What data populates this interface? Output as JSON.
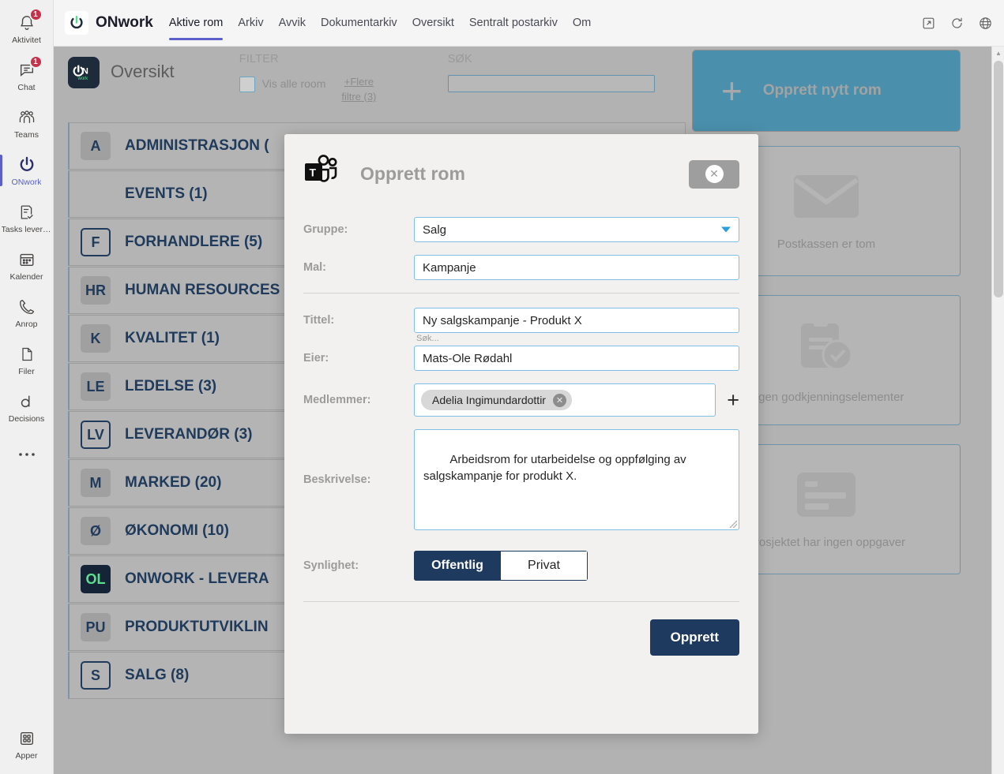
{
  "rail": {
    "items": [
      {
        "label": "Aktivitet",
        "icon": "bell-icon",
        "badge": "1",
        "active": false
      },
      {
        "label": "Chat",
        "icon": "chat-icon",
        "badge": "1",
        "active": false
      },
      {
        "label": "Teams",
        "icon": "teams-people-icon",
        "badge": "",
        "active": false
      },
      {
        "label": "ONwork",
        "icon": "power-icon",
        "badge": "",
        "active": true
      },
      {
        "label": "Tasks levert...",
        "icon": "tasks-icon",
        "badge": "",
        "active": false
      },
      {
        "label": "Kalender",
        "icon": "calendar-icon",
        "badge": "",
        "active": false
      },
      {
        "label": "Anrop",
        "icon": "phone-icon",
        "badge": "",
        "active": false
      },
      {
        "label": "Filer",
        "icon": "file-icon",
        "badge": "",
        "active": false
      },
      {
        "label": "Decisions",
        "icon": "decisions-icon",
        "badge": "",
        "active": false
      },
      {
        "label": "",
        "icon": "more-ellipsis-icon",
        "badge": "",
        "active": false
      }
    ],
    "bottom": {
      "label": "Apper",
      "icon": "apps-grid-icon"
    }
  },
  "topbar": {
    "logo_icon": "onwork-power-logo",
    "brand": "ONwork",
    "nav": [
      {
        "label": "Aktive rom",
        "active": true
      },
      {
        "label": "Arkiv",
        "active": false
      },
      {
        "label": "Avvik",
        "active": false
      },
      {
        "label": "Dokumentarkiv",
        "active": false
      },
      {
        "label": "Oversikt",
        "active": false
      },
      {
        "label": "Sentralt postarkiv",
        "active": false
      },
      {
        "label": "Om",
        "active": false
      }
    ],
    "actions": [
      {
        "icon": "pop-out-icon"
      },
      {
        "icon": "refresh-icon"
      },
      {
        "icon": "globe-icon"
      }
    ]
  },
  "page": {
    "logo_icon": "onwork-logo",
    "title": "Oversikt",
    "filter": {
      "section_label": "FILTER",
      "checkbox_label": "Vis alle room",
      "checkbox_checked": false,
      "more_filters": "+Flere filtre (3)"
    },
    "search": {
      "section_label": "SØK",
      "value": "",
      "placeholder": ""
    },
    "create_button": {
      "icon": "plus-icon",
      "label": "Opprett nytt rom",
      "color": "#4a8fab"
    },
    "rooms": [
      {
        "initials": "A",
        "avatar_style": "filled",
        "name": "ADMINISTRASJON ("
      },
      {
        "initials": "",
        "avatar_style": "none",
        "name": "EVENTS (1)"
      },
      {
        "initials": "F",
        "avatar_style": "outline",
        "name": "FORHANDLERE (5)"
      },
      {
        "initials": "HR",
        "avatar_style": "filled",
        "name": "HUMAN RESOURCES"
      },
      {
        "initials": "K",
        "avatar_style": "filled",
        "name": "KVALITET (1)"
      },
      {
        "initials": "LE",
        "avatar_style": "filled",
        "name": "LEDELSE (3)"
      },
      {
        "initials": "LV",
        "avatar_style": "outline",
        "name": "LEVERANDØR (3)"
      },
      {
        "initials": "M",
        "avatar_style": "filled",
        "name": "MARKED (20)"
      },
      {
        "initials": "Ø",
        "avatar_style": "filled",
        "name": "ØKONOMI (10)"
      },
      {
        "initials": "OL",
        "avatar_style": "dark",
        "name": "ONWORK - LEVERA"
      },
      {
        "initials": "PU",
        "avatar_style": "filled",
        "name": "PRODUKTUTVIKLIN"
      },
      {
        "initials": "S",
        "avatar_style": "outline",
        "name": "SALG (8)"
      }
    ],
    "cards": [
      {
        "icon": "envelope-icon",
        "text": "Postkassen er tom"
      },
      {
        "icon": "clipboard-check-icon",
        "text": "Ingen godkjenningselementer"
      },
      {
        "icon": "task-list-icon",
        "text": "Prosjektet har ingen oppgaver"
      }
    ]
  },
  "modal": {
    "icon": "microsoft-teams-icon",
    "title": "Opprett rom",
    "close_icon": "close-icon",
    "fields": {
      "gruppe": {
        "label": "Gruppe:",
        "value": "Salg",
        "caret_icon": "chevron-down-icon"
      },
      "mal": {
        "label": "Mal:",
        "value": "Kampanje"
      },
      "tittel": {
        "label": "Tittel:",
        "value": "Ny salgskampanje - Produkt X"
      },
      "eier": {
        "label": "Eier:",
        "value": "Mats-Ole Rødahl",
        "hint": "Søk..."
      },
      "medlemmer": {
        "label": "Medlemmer:",
        "chips": [
          {
            "name": "Adelia Ingimundardottir",
            "remove_icon": "chip-remove-icon"
          }
        ],
        "add_icon": "plus-icon"
      },
      "beskrivelse": {
        "label": "Beskrivelse:",
        "value": "Arbeidsrom for utarbeidelse og oppfølging av salgskampanje for produkt X."
      },
      "synlighet": {
        "label": "Synlighet:",
        "options": [
          {
            "label": "Offentlig",
            "selected": true
          },
          {
            "label": "Privat",
            "selected": false
          }
        ]
      }
    },
    "submit_label": "Opprett",
    "accent_color": "#1e3a5f"
  }
}
